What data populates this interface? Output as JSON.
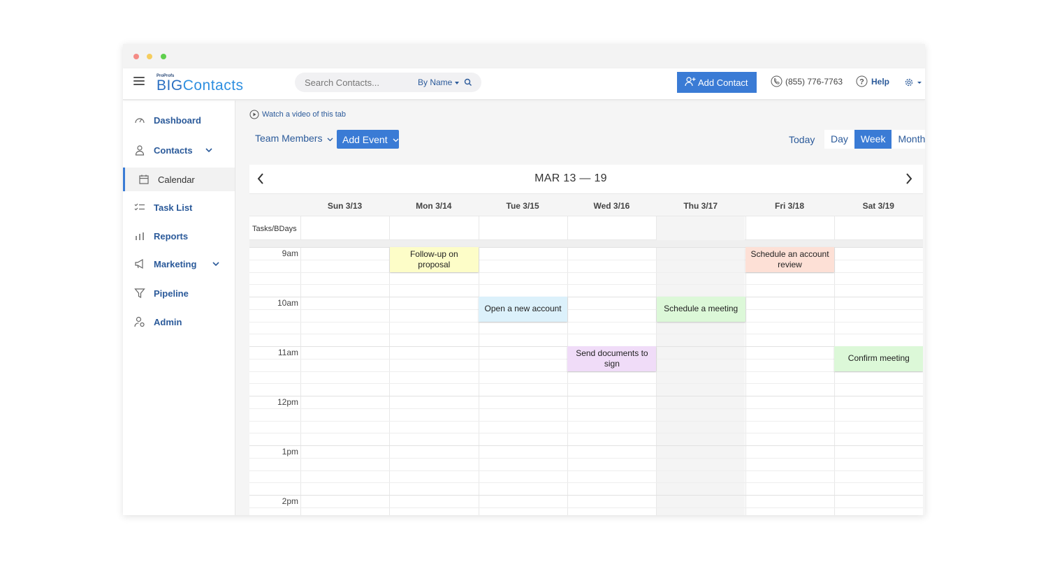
{
  "window": {
    "controls": [
      "close",
      "minimize",
      "zoom"
    ]
  },
  "header": {
    "logo_top": "ProProfs",
    "logo_big": "BIG",
    "logo_rest": "Contacts",
    "search": {
      "placeholder": "Search Contacts...",
      "value": "",
      "filter_label": "By Name"
    },
    "add_contact_label": "Add Contact",
    "phone": "(855) 776-7763",
    "help_label": "Help",
    "icons": {
      "menu": "hamburger-icon",
      "search": "search-icon",
      "add_contact": "add-user-icon",
      "phone": "phone-icon",
      "help": "help-icon",
      "settings": "gear-icon"
    }
  },
  "sidebar": {
    "items": [
      {
        "label": "Dashboard",
        "icon": "dashboard-icon",
        "expandable": false,
        "active": false
      },
      {
        "label": "Contacts",
        "icon": "user-icon",
        "expandable": true,
        "active": false
      },
      {
        "label": "Calendar",
        "icon": "calendar-icon",
        "expandable": false,
        "active": true
      },
      {
        "label": "Task List",
        "icon": "task-list-icon",
        "expandable": false,
        "active": false
      },
      {
        "label": "Reports",
        "icon": "bar-chart-icon",
        "expandable": false,
        "active": false
      },
      {
        "label": "Marketing",
        "icon": "megaphone-icon",
        "expandable": true,
        "active": false
      },
      {
        "label": "Pipeline",
        "icon": "funnel-icon",
        "expandable": false,
        "active": false
      },
      {
        "label": "Admin",
        "icon": "admin-icon",
        "expandable": false,
        "active": false
      }
    ]
  },
  "toolbar": {
    "video_link": "Watch a video of this tab",
    "team_members": "Team Members",
    "add_event": "Add Event",
    "today": "Today",
    "views": [
      {
        "label": "Day",
        "active": false
      },
      {
        "label": "Week",
        "active": true
      },
      {
        "label": "Month",
        "active": false
      }
    ]
  },
  "calendar": {
    "title": "MAR 13 — 19",
    "tasks_row_label": "Tasks/BDays",
    "days": [
      "Sun 3/13",
      "Mon 3/14",
      "Tue 3/15",
      "Wed 3/16",
      "Thu 3/17",
      "Fri 3/18",
      "Sat 3/19"
    ],
    "highlighted_day": "Thu 3/17",
    "times": [
      "9am",
      "10am",
      "11am",
      "12pm",
      "1pm",
      "2pm"
    ],
    "events": [
      {
        "title": "Follow-up on proposal",
        "day": "Mon 3/14",
        "start": "9:00",
        "end": "9:30",
        "color": "#fdfdc8"
      },
      {
        "title": "Schedule an account review",
        "day": "Fri 3/18",
        "start": "9:00",
        "end": "9:30",
        "color": "#fde0d6"
      },
      {
        "title": "Open a new account",
        "day": "Tue 3/15",
        "start": "10:00",
        "end": "10:30",
        "color": "#dcf1fb"
      },
      {
        "title": "Schedule a meeting",
        "day": "Thu 3/17",
        "start": "10:00",
        "end": "10:30",
        "color": "#dcf8d8"
      },
      {
        "title": "Send documents to sign",
        "day": "Wed 3/16",
        "start": "11:00",
        "end": "11:30",
        "color": "#f0dcf8"
      },
      {
        "title": "Confirm meeting",
        "day": "Sat 3/19",
        "start": "11:00",
        "end": "11:30",
        "color": "#dcf8d8"
      }
    ]
  },
  "colors": {
    "accent": "#3a7bd5",
    "link": "#2b5a9a"
  }
}
